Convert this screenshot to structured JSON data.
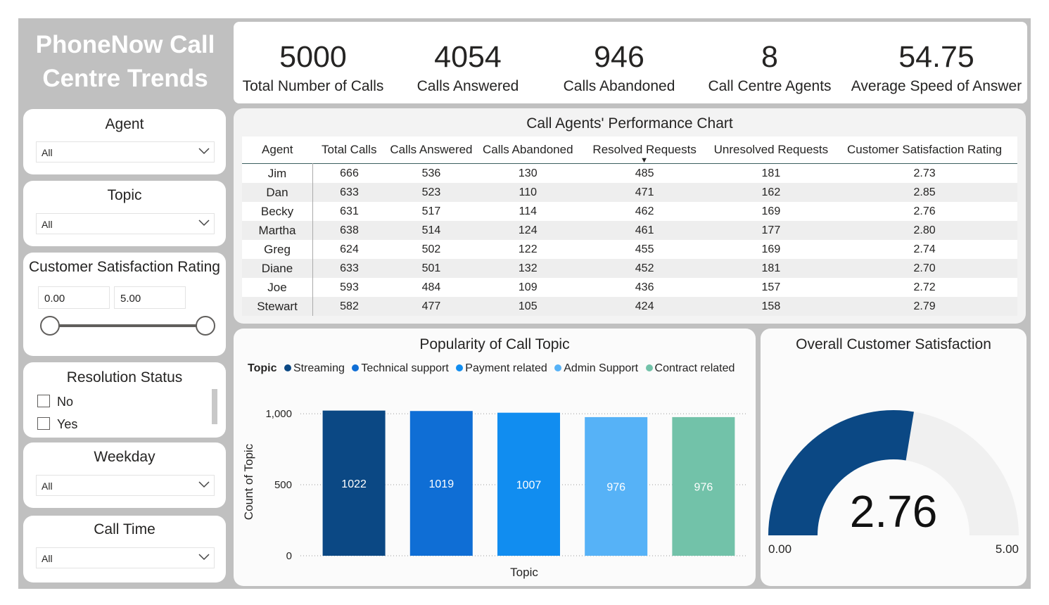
{
  "app_title": "PhoneNow Call Centre Trends",
  "kpis": [
    {
      "value": "5000",
      "label": "Total Number of Calls"
    },
    {
      "value": "4054",
      "label": "Calls Answered"
    },
    {
      "value": "946",
      "label": "Calls Abandoned"
    },
    {
      "value": "8",
      "label": "Call Centre Agents"
    },
    {
      "value": "54.75",
      "label": "Average Speed of Answer"
    }
  ],
  "filters": {
    "agent": {
      "title": "Agent",
      "value": "All"
    },
    "topic": {
      "title": "Topic",
      "value": "All"
    },
    "satisfaction": {
      "title": "Customer Satisfaction Rating",
      "min": "0.00",
      "max": "5.00"
    },
    "resolution": {
      "title": "Resolution Status",
      "options": [
        "No",
        "Yes"
      ]
    },
    "weekday": {
      "title": "Weekday",
      "value": "All"
    },
    "call_time": {
      "title": "Call Time",
      "value": "All"
    }
  },
  "table": {
    "title": "Call Agents' Performance Chart",
    "columns": [
      "Agent",
      "Total Calls",
      "Calls Answered",
      "Calls Abandoned",
      "Resolved Requests",
      "Unresolved Requests",
      "Customer Satisfaction Rating"
    ],
    "sort_column": "Resolved Requests",
    "rows": [
      [
        "Jim",
        "666",
        "536",
        "130",
        "485",
        "181",
        "2.73"
      ],
      [
        "Dan",
        "633",
        "523",
        "110",
        "471",
        "162",
        "2.85"
      ],
      [
        "Becky",
        "631",
        "517",
        "114",
        "462",
        "169",
        "2.76"
      ],
      [
        "Martha",
        "638",
        "514",
        "124",
        "461",
        "177",
        "2.80"
      ],
      [
        "Greg",
        "624",
        "502",
        "122",
        "455",
        "169",
        "2.74"
      ],
      [
        "Diane",
        "633",
        "501",
        "132",
        "452",
        "181",
        "2.70"
      ],
      [
        "Joe",
        "593",
        "484",
        "109",
        "436",
        "157",
        "2.72"
      ],
      [
        "Stewart",
        "582",
        "477",
        "105",
        "424",
        "158",
        "2.79"
      ]
    ]
  },
  "chart_data": [
    {
      "type": "bar",
      "title": "Popularity of Call Topic",
      "legend_title": "Topic",
      "legend_position": "top-left",
      "categories": [
        "Streaming",
        "Technical support",
        "Payment related",
        "Admin Support",
        "Contract related"
      ],
      "values": [
        1022,
        1019,
        1007,
        976,
        976
      ],
      "colors": [
        "#0b4884",
        "#0f6ed5",
        "#118df0",
        "#56b2f7",
        "#72c2a9"
      ],
      "xlabel": "Topic",
      "ylabel": "Count of Topic",
      "yticks": [
        "0",
        "500",
        "1,000"
      ],
      "ylim": [
        0,
        1040
      ],
      "grid": true
    },
    {
      "type": "gauge",
      "title": "Overall Customer Satisfaction",
      "value": 2.76,
      "value_label": "2.76",
      "min": 0,
      "max": 5,
      "min_label": "0.00",
      "max_label": "5.00",
      "fill_color": "#0b4884",
      "track_color": "#f0f0f0"
    }
  ]
}
